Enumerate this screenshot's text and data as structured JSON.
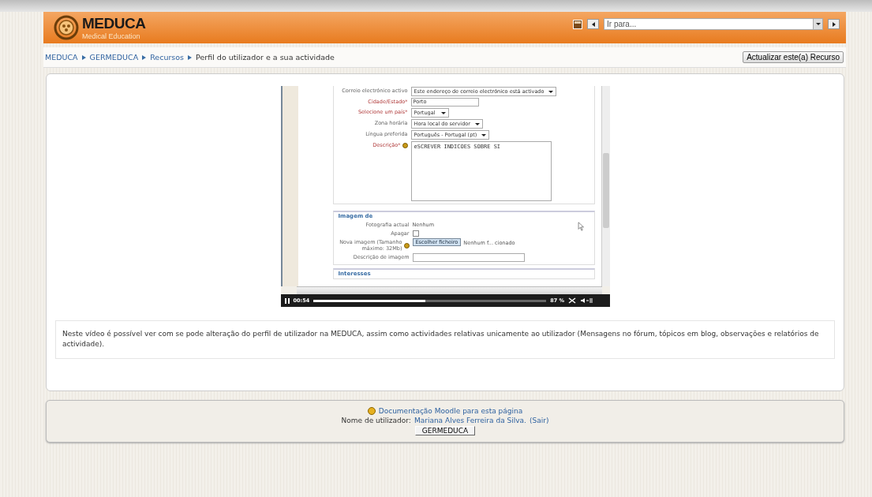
{
  "header": {
    "logo_title": "MEDUCA",
    "logo_subtitle": "Medical Education",
    "jump_select": {
      "placeholder": "Ir para..."
    }
  },
  "breadcrumb": [
    {
      "label": "MEDUCA",
      "link": true
    },
    {
      "label": "GERMEDUCA",
      "link": true
    },
    {
      "label": "Recursos",
      "link": true
    },
    {
      "label": "Perfil do utilizador e a sua actividade",
      "link": false
    }
  ],
  "update_button": "Actualizar este(a) Recurso",
  "video": {
    "fields": [
      {
        "kind": "select",
        "label": "Correio electrónico activo",
        "required": false,
        "value": "Este endereço de correio electrónico está activado"
      },
      {
        "kind": "text",
        "label": "Cidade/Estado*",
        "required": true,
        "value": "Porto"
      },
      {
        "kind": "select",
        "label": "Selecione um país*",
        "required": true,
        "value": "Portugal"
      },
      {
        "kind": "select",
        "label": "Zona horária",
        "required": false,
        "value": "Hora local do servidor"
      },
      {
        "kind": "select",
        "label": "Língua preferida",
        "required": false,
        "value": "Português - Portugal (pt)"
      },
      {
        "kind": "textarea",
        "label": "Descrição*",
        "required": true,
        "help": true,
        "value": "eSCREVER INDICOES SOBRE SI"
      }
    ],
    "image_section": {
      "title": "Imagem de",
      "fields": [
        {
          "kind": "static",
          "label": "Fotografia actual",
          "value": "Nenhum"
        },
        {
          "kind": "checkbox",
          "label": "Apagar",
          "checked": false
        },
        {
          "kind": "file",
          "label": "Nova imagem (Tamanho máximo: 32Mb)",
          "help": true,
          "button": "Escolher ficheiro",
          "value": "Nenhum f... cionado"
        },
        {
          "kind": "text",
          "label": "Descrição de imagem"
        }
      ]
    },
    "next_section": "Interesses",
    "player": {
      "time": "00:54",
      "level": 0.48,
      "zoom": "87 %"
    }
  },
  "description": "Neste vídeo é possível ver com se pode alteração do perfil de utilizador na MEDUCA, assim como actividades relativas unicamente ao utilizador (Mensagens no fórum, tópicos em blog, observações e relatórios de actividade).",
  "footer": {
    "doc_link": "Documentação Moodle para esta página",
    "user_label": "Nome de utilizador:",
    "user_name": "Mariana Alves Ferreira da Silva.",
    "logout": "(Sair)",
    "course_button": "GERMEDUCA"
  }
}
